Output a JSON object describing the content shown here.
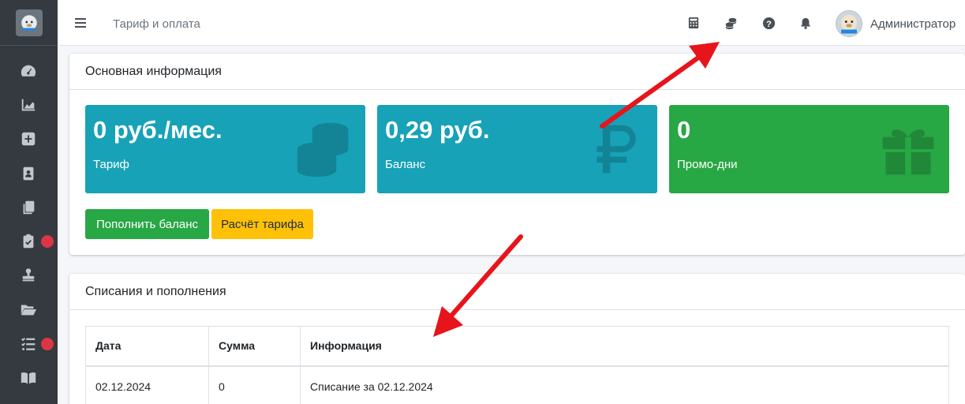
{
  "header": {
    "breadcrumb": "Тариф и оплата",
    "user_name": "Администратор",
    "icons": [
      "calculator-icon",
      "coins-icon",
      "help-icon",
      "bell-icon"
    ]
  },
  "sidebar": {
    "items": [
      {
        "icon": "dashboard-icon",
        "badge": false
      },
      {
        "icon": "chart-area-icon",
        "badge": false
      },
      {
        "icon": "plus-square-icon",
        "badge": false
      },
      {
        "icon": "id-card-icon",
        "badge": false
      },
      {
        "icon": "copy-icon",
        "badge": false
      },
      {
        "icon": "clipboard-check-icon",
        "badge": true
      },
      {
        "icon": "stamp-icon",
        "badge": false
      },
      {
        "icon": "folder-open-icon",
        "badge": false
      },
      {
        "icon": "tasks-icon",
        "badge": true
      },
      {
        "icon": "book-icon",
        "badge": false
      }
    ]
  },
  "summary": {
    "title": "Основная информация",
    "boxes": [
      {
        "value": "0 руб./мес.",
        "label": "Тариф",
        "color": "#17a2b8",
        "icon": "coins-icon"
      },
      {
        "value": "0,29 руб.",
        "label": "Баланс",
        "color": "#17a2b8",
        "icon": "ruble-icon"
      },
      {
        "value": "0",
        "label": "Промо-дни",
        "color": "#28a745",
        "icon": "gift-icon"
      }
    ],
    "buttons": {
      "topup": "Пополнить баланс",
      "calc": "Расчёт тарифа"
    }
  },
  "transactions": {
    "title": "Списания и пополнения",
    "columns": [
      "Дата",
      "Сумма",
      "Информация"
    ],
    "rows": [
      {
        "date": "02.12.2024",
        "amount": "0",
        "info": "Списание за 02.12.2024"
      }
    ]
  },
  "colors": {
    "sidebar": "#343a40",
    "info": "#17a2b8",
    "success": "#28a745",
    "warning": "#ffc107",
    "annotation": "#e8141b"
  }
}
